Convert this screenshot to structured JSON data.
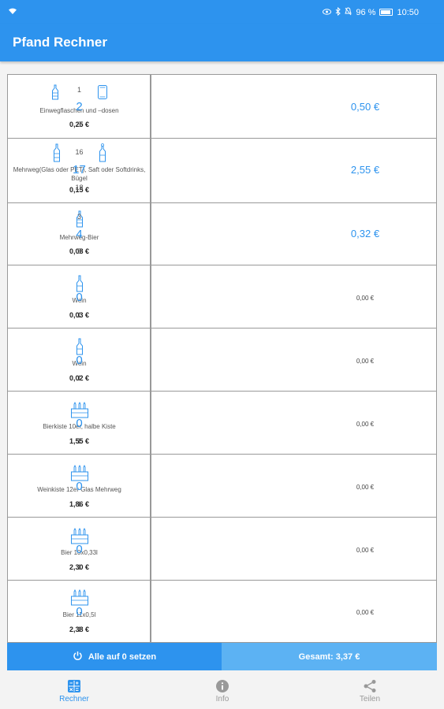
{
  "status": {
    "battery": "96 %",
    "time": "10:50"
  },
  "app": {
    "title": "Pfand Rechner"
  },
  "rows": [
    {
      "desc": "Einwegflaschen und –dosen",
      "price": "0,25 €",
      "prev": "1",
      "qty": "2",
      "next": "3",
      "total": "0,50 €",
      "icons": [
        "bottle-icon",
        "can-icon"
      ]
    },
    {
      "desc": "Mehrweg(Glas oder PET), Saft oder Softdrinks, Bügel",
      "price": "0,15 €",
      "prev": "16",
      "qty": "17",
      "next": "18",
      "total": "2,55 €",
      "icons": [
        "bottle-icon",
        "swing-top-bottle-icon"
      ]
    },
    {
      "desc": "Mehrweg-Bier",
      "price": "0,08 €",
      "prev": "3",
      "qty": "4",
      "next": "5",
      "total": "0,32 €",
      "icons": [
        "beer-bottle-icon"
      ]
    },
    {
      "desc": "Wein",
      "price": "0,03 €",
      "prev": "",
      "qty": "0",
      "next": "1",
      "total": "0,00 €",
      "icons": [
        "wine-bottle-icon"
      ]
    },
    {
      "desc": "Wein",
      "price": "0,02 €",
      "prev": "",
      "qty": "0",
      "next": "1",
      "total": "0,00 €",
      "icons": [
        "wine-bottle-icon"
      ]
    },
    {
      "desc": "Bierkiste 10er, halbe Kiste",
      "price": "1,55 €",
      "prev": "",
      "qty": "0",
      "next": "1",
      "total": "0,00 €",
      "icons": [
        "crate-icon"
      ]
    },
    {
      "desc": "Weinkiste 12er Glas Mehrweg",
      "price": "1,86 €",
      "prev": "",
      "qty": "0",
      "next": "1",
      "total": "0,00 €",
      "icons": [
        "crate-icon"
      ]
    },
    {
      "desc": "Bier 10x0,33l",
      "price": "2,30 €",
      "prev": "",
      "qty": "0",
      "next": "1",
      "total": "0,00 €",
      "icons": [
        "crate-icon"
      ]
    },
    {
      "desc": "Bier 11x0,5l",
      "price": "2,38 €",
      "prev": "",
      "qty": "0",
      "next": "1",
      "total": "0,00 €",
      "icons": [
        "crate-icon"
      ]
    }
  ],
  "actions": {
    "reset_label": "Alle auf 0 setzen",
    "sum_label": "Gesamt: 3,37 €"
  },
  "nav": [
    {
      "label": "Rechner",
      "icon": "calculator-icon",
      "active": true
    },
    {
      "label": "Info",
      "icon": "info-icon",
      "active": false
    },
    {
      "label": "Teilen",
      "icon": "share-icon",
      "active": false
    }
  ],
  "colors": {
    "primary": "#2d93ee",
    "primary_light": "#5cb2f3"
  }
}
